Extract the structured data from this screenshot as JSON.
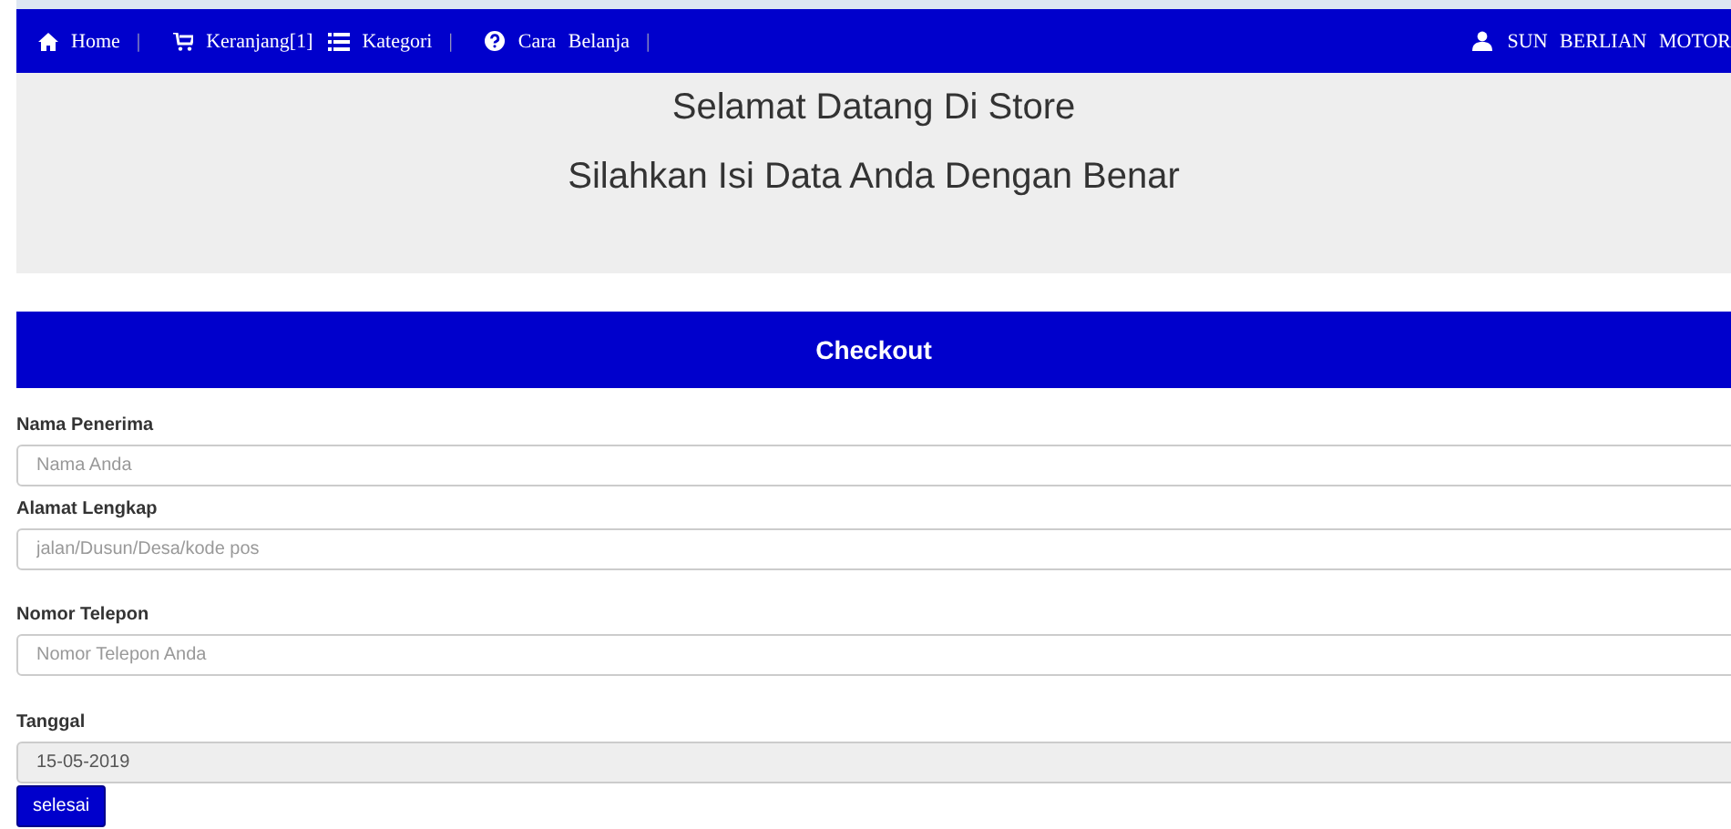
{
  "navbar": {
    "items": [
      {
        "kind": "home",
        "label": "Home",
        "separator": "|"
      },
      {
        "kind": "cart",
        "label": "Keranjang[1]"
      },
      {
        "kind": "list",
        "label": "Kategori",
        "separator": "|"
      },
      {
        "kind": "help",
        "label": "Cara Belanja",
        "separator": "|"
      }
    ],
    "user": {
      "label": "SUN BERLIAN MOTOR"
    }
  },
  "banner": {
    "title": "Selamat Datang Di Store",
    "subtitle": "Silahkan Isi Data Anda Dengan Benar"
  },
  "checkout": {
    "heading": "Checkout",
    "fields": [
      {
        "label": "Nama Penerima",
        "placeholder": "Nama Anda",
        "disabled": false
      },
      {
        "label": "Alamat Lengkap",
        "placeholder": "jalan/Dusun/Desa/kode pos",
        "disabled": false
      },
      {
        "label": "Nomor Telepon",
        "placeholder": "Nomor Telepon Anda",
        "disabled": false
      },
      {
        "label": "Tanggal",
        "value": "15-05-2019",
        "disabled": true
      }
    ],
    "submit": "selesai"
  }
}
